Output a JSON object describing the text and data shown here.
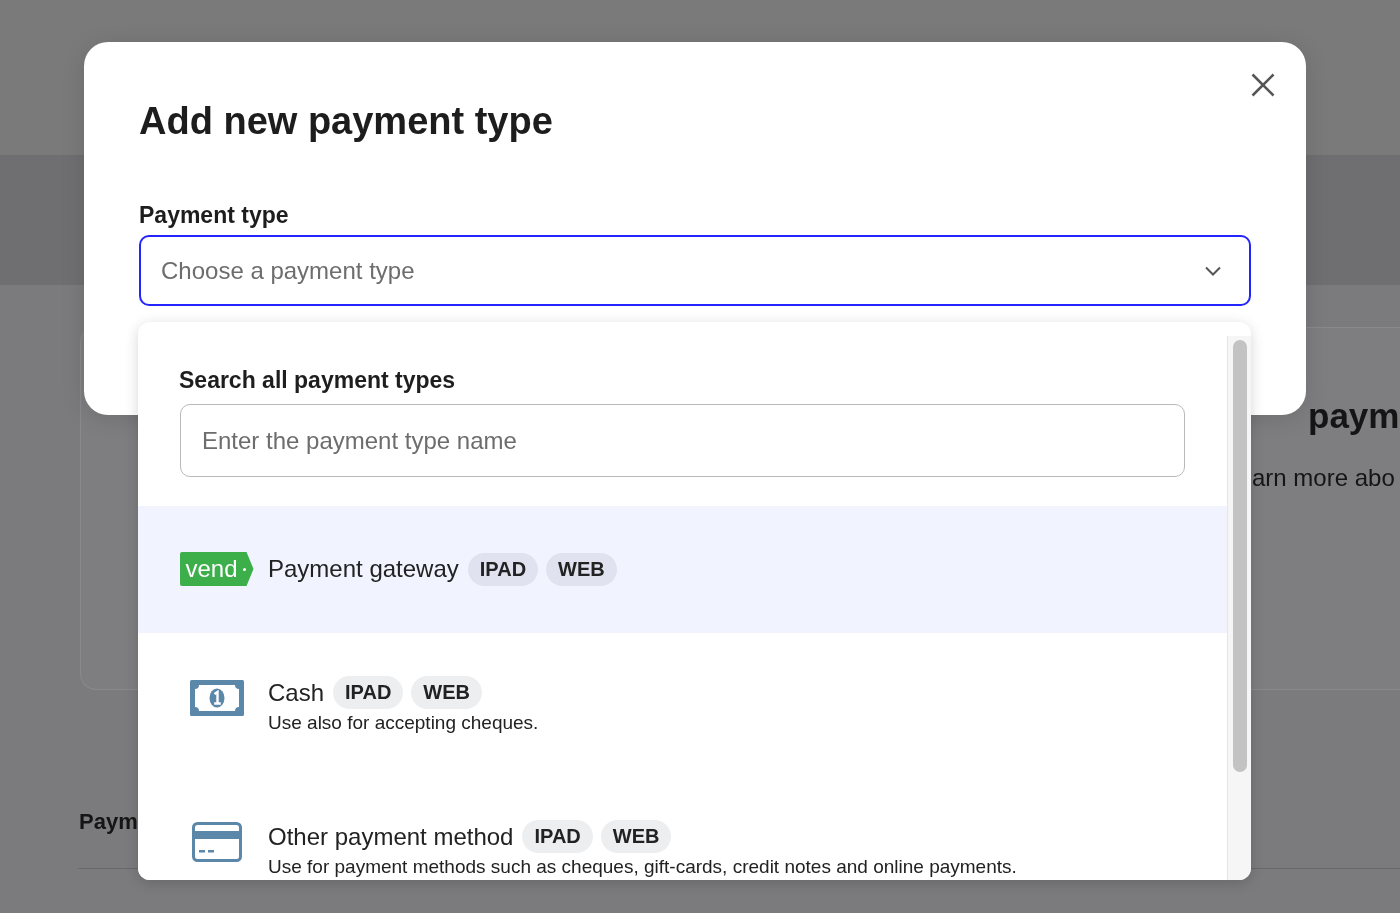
{
  "background": {
    "card": {
      "heading": "paym",
      "text": "arn more abo"
    },
    "section_heading": "Paym"
  },
  "dialog": {
    "title": "Add new payment type",
    "field": {
      "label": "Payment type",
      "placeholder": "Choose a payment type",
      "focused": true,
      "expanded": true
    },
    "dropdown": {
      "search": {
        "label": "Search all payment types",
        "placeholder": "Enter the payment type name"
      },
      "options": [
        {
          "kind": "gateway",
          "logo_text": "vend",
          "title": "Payment gateway",
          "tags": [
            "IPAD",
            "WEB"
          ],
          "selected": true
        },
        {
          "kind": "cash",
          "title": "Cash",
          "tags": [
            "IPAD",
            "WEB"
          ],
          "description": "Use also for accepting cheques.",
          "selected": false
        },
        {
          "kind": "card",
          "title": "Other payment method",
          "tags": [
            "IPAD",
            "WEB"
          ],
          "description": "Use for payment methods such as cheques, gift-cards, credit notes and online payments.",
          "selected": false
        }
      ]
    }
  }
}
